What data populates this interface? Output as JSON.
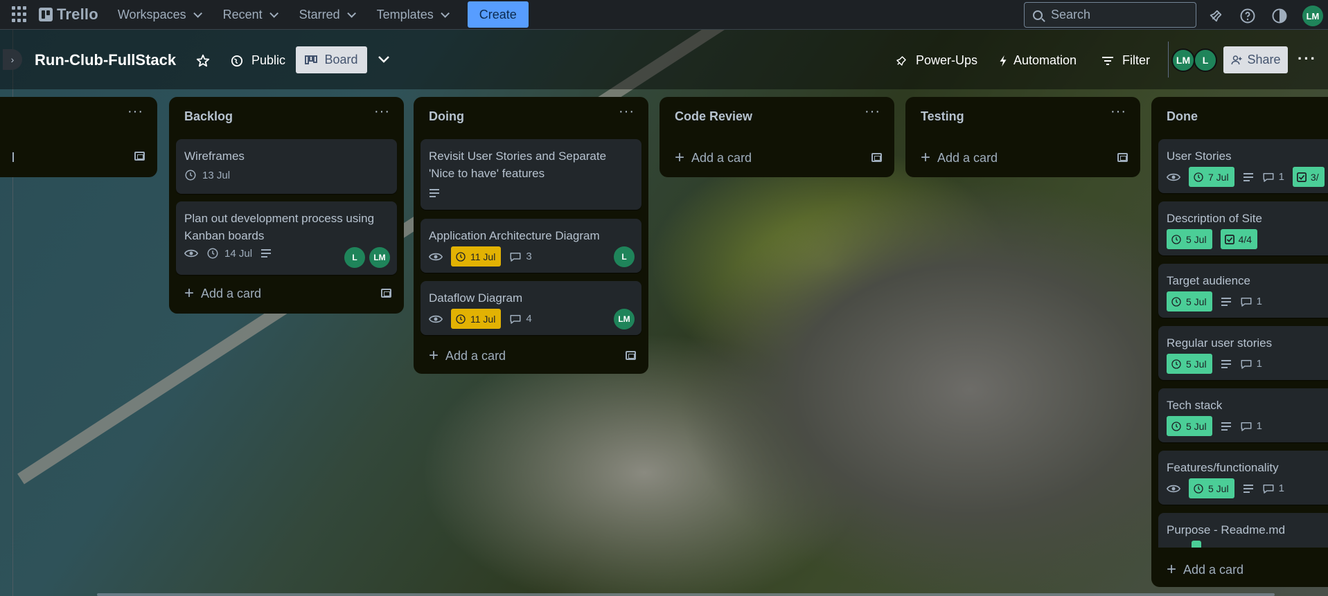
{
  "nav": {
    "brand": "Trello",
    "menu": [
      "Workspaces",
      "Recent",
      "Starred",
      "Templates"
    ],
    "create_label": "Create",
    "search_placeholder": "Search",
    "user_initials": "LM"
  },
  "board": {
    "title": "Run-Club-FullStack",
    "visibility": "Public",
    "view": "Board",
    "power_ups": "Power-Ups",
    "automation": "Automation",
    "filter": "Filter",
    "members": [
      "LM",
      "L"
    ],
    "share": "Share"
  },
  "lists": [
    {
      "title": ""
    },
    {
      "title": "Backlog",
      "add_label": "Add a card",
      "cards": [
        {
          "title": "Wireframes",
          "due": "13 Jul"
        },
        {
          "title": "Plan out development process using Kanban boards",
          "due": "14 Jul",
          "members": [
            "L",
            "LM"
          ]
        }
      ]
    },
    {
      "title": "Doing",
      "add_label": "Add a card",
      "cards": [
        {
          "title": "Revisit User Stories and Separate 'Nice to have' features"
        },
        {
          "title": "Application Architecture Diagram",
          "due": "11 Jul",
          "comments": "3",
          "members": [
            "L"
          ]
        },
        {
          "title": "Dataflow Diagram",
          "due": "11 Jul",
          "comments": "4",
          "members": [
            "LM"
          ]
        }
      ]
    },
    {
      "title": "Code Review",
      "add_label": "Add a card"
    },
    {
      "title": "Testing",
      "add_label": "Add a card"
    },
    {
      "title": "Done",
      "add_label": "Add a card",
      "cards": [
        {
          "title": "User Stories",
          "due": "7 Jul",
          "comments": "1",
          "checklist": "3/"
        },
        {
          "title": "Description of Site",
          "due": "5 Jul",
          "checklist": "4/4"
        },
        {
          "title": "Target audience",
          "due": "5 Jul",
          "comments": "1"
        },
        {
          "title": "Regular user stories",
          "due": "5 Jul",
          "comments": "1"
        },
        {
          "title": "Tech stack",
          "due": "5 Jul",
          "comments": "1"
        },
        {
          "title": "Features/functionality",
          "due": "5 Jul",
          "comments": "1"
        },
        {
          "title": "Purpose - Readme.md"
        }
      ]
    }
  ],
  "colors": {
    "accent": "#579dff",
    "done_badge": "#4bce97",
    "due_soon": "#e2b203",
    "list_bg": "#101204",
    "card_bg": "#22272b"
  }
}
